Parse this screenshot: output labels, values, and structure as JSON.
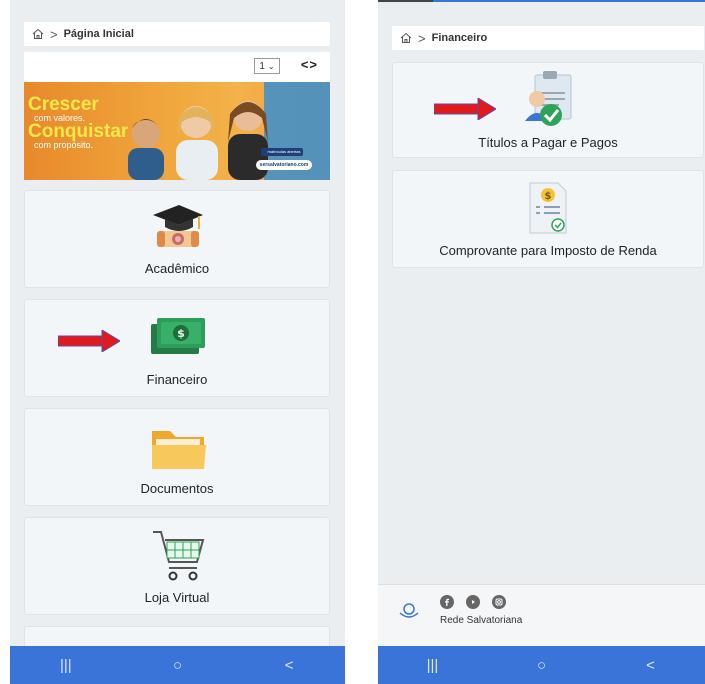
{
  "left": {
    "breadcrumb": {
      "label": "Página Inicial"
    },
    "banner": {
      "pager_value": "1",
      "pager_arrows": "<>",
      "headline1": "Crescer",
      "sub1": "com valores.",
      "headline2": "Conquistar",
      "sub2": "com propósito.",
      "badge": "matrículas abertas",
      "url": "sersalvatoriano.com"
    },
    "cards": [
      {
        "label": "Acadêmico"
      },
      {
        "label": "Financeiro"
      },
      {
        "label": "Documentos"
      },
      {
        "label": "Loja Virtual"
      }
    ]
  },
  "right": {
    "breadcrumb": {
      "label": "Financeiro"
    },
    "cards": [
      {
        "label": "Títulos a Pagar e Pagos"
      },
      {
        "label": "Comprovante para Imposto de Renda"
      }
    ],
    "footer": {
      "label": "Rede Salvatoriana"
    }
  },
  "nav": {
    "recent": "|||",
    "home": "○",
    "back": "<"
  },
  "colors": {
    "arrow": "#e11b1b",
    "navbar": "#3a74d8",
    "money_green": "#2e9d5b",
    "check_green": "#2fa35a"
  }
}
